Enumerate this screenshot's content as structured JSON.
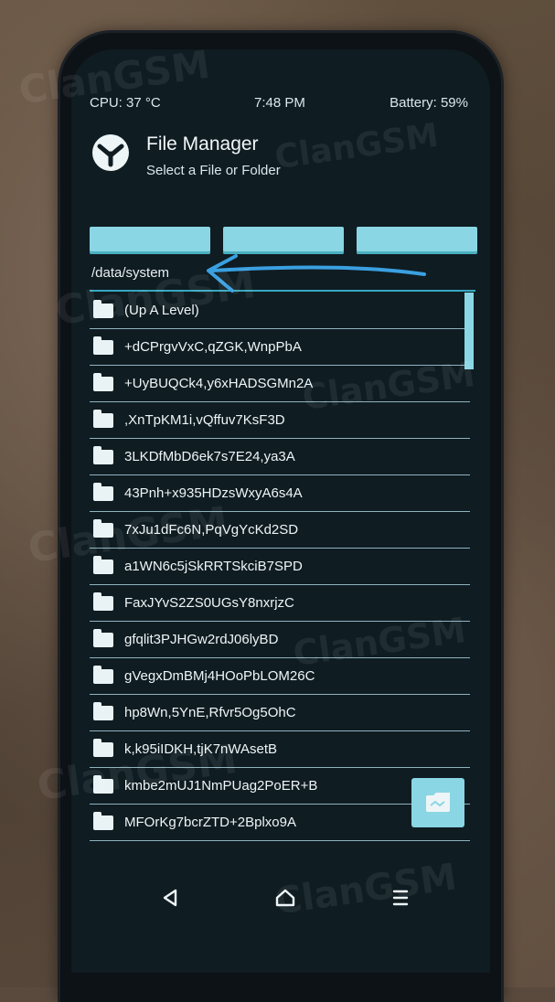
{
  "status": {
    "cpu": "CPU: 37 °C",
    "time": "7:48 PM",
    "battery": "Battery: 59%"
  },
  "header": {
    "title": "File Manager",
    "subtitle": "Select a File or Folder"
  },
  "toolbar": {
    "buttons": [
      "",
      "",
      ""
    ]
  },
  "path": "/data/system",
  "files": [
    "(Up A Level)",
    "+dCPrgvVxC,qZGK,WnpPbA",
    "+UyBUQCk4,y6xHADSGMn2A",
    ",XnTpKM1i,vQffuv7KsF3D",
    "3LKDfMbD6ek7s7E24,ya3A",
    "43Pnh+x935HDzsWxyA6s4A",
    "7xJu1dFc6N,PqVgYcKd2SD",
    "a1WN6c5jSkRRTSkciB7SPD",
    "FaxJYvS2ZS0UGsY8nxrjzC",
    "gfqlit3PJHGw2rdJ06lyBD",
    "gVegxDmBMj4HOoPbLOM26C",
    "hp8Wn,5YnE,Rfvr5Og5OhC",
    "k,k95iIDKH,tjK7nWAsetB",
    "kmbe2mUJ1NmPUag2PoER+B",
    "MFOrKg7bcrZTD+2Bplxo9A"
  ],
  "icons": {
    "folder": "folder-icon",
    "fab": "select-storage-icon",
    "back": "back-triangle-icon",
    "home": "home-icon",
    "menu": "menu-lines-icon",
    "logo": "twrp-logo-icon",
    "annotation": "blue-arrow-annotation"
  },
  "colors": {
    "accent": "#8ad6e4",
    "screen_bg": "#0f1c22",
    "annotation": "#3aa0e0"
  },
  "watermark": "ClanGSM"
}
